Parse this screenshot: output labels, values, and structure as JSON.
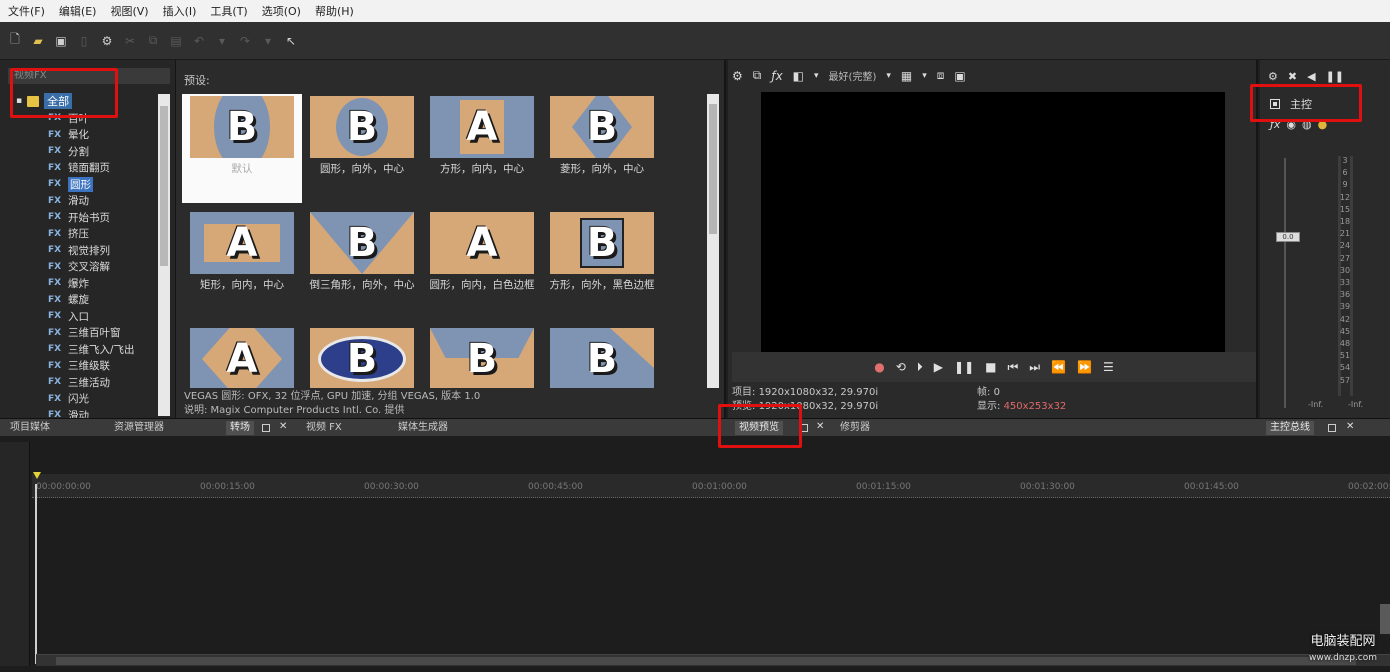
{
  "menu": [
    "文件(F)",
    "编辑(E)",
    "视图(V)",
    "插入(I)",
    "工具(T)",
    "选项(O)",
    "帮助(H)"
  ],
  "tree": {
    "header": "视频FX",
    "root_label": "全部",
    "items": [
      {
        "fx": "FX",
        "label": "百叶"
      },
      {
        "fx": "FX",
        "label": "晕化"
      },
      {
        "fx": "FX",
        "label": "分割"
      },
      {
        "fx": "FX",
        "label": "镜面翻页"
      },
      {
        "fx": "FX",
        "label": "圆形",
        "selected": true
      },
      {
        "fx": "FX",
        "label": "滑动"
      },
      {
        "fx": "FX",
        "label": "开始书页"
      },
      {
        "fx": "FX",
        "label": "挤压"
      },
      {
        "fx": "FX",
        "label": "视觉排列"
      },
      {
        "fx": "FX",
        "label": "交叉溶解"
      },
      {
        "fx": "FX",
        "label": "爆炸"
      },
      {
        "fx": "FX",
        "label": "螺旋"
      },
      {
        "fx": "FX",
        "label": "入口"
      },
      {
        "fx": "FX",
        "label": "三维百叶窗"
      },
      {
        "fx": "FX",
        "label": "三维飞入/飞出"
      },
      {
        "fx": "FX",
        "label": "三维级联"
      },
      {
        "fx": "FX",
        "label": "三维活动"
      },
      {
        "fx": "FX",
        "label": "闪光"
      },
      {
        "fx": "FX",
        "label": "滑动"
      }
    ]
  },
  "presets": {
    "label": "预设:",
    "items": [
      {
        "letter": "B",
        "caption": "默认",
        "bg": "tan",
        "shape": "circle-full",
        "selected": true
      },
      {
        "letter": "B",
        "caption": "圆形，向外，中心",
        "bg": "tan",
        "shape": "circle"
      },
      {
        "letter": "A",
        "caption": "方形，向内，中心",
        "bg": "blue",
        "shape": "square-tan"
      },
      {
        "letter": "B",
        "caption": "菱形，向外，中心",
        "bg": "tan",
        "shape": "diamond"
      },
      {
        "letter": "A",
        "caption": "矩形，向内，中心",
        "bg": "blue",
        "shape": "rect-tan"
      },
      {
        "letter": "B",
        "caption": "倒三角形，向外，中心",
        "bg": "tan",
        "shape": "triangle"
      },
      {
        "letter": "A",
        "caption": "圆形，向内，白色边框",
        "bg": "tan",
        "shape": "none"
      },
      {
        "letter": "B",
        "caption": "方形，向外，黑色边框",
        "bg": "tan",
        "shape": "square-border"
      },
      {
        "letter": "A",
        "caption": "",
        "bg": "blue",
        "shape": "diamond-tan"
      },
      {
        "letter": "B",
        "caption": "",
        "bg": "tan",
        "shape": "ellipse"
      },
      {
        "letter": "B",
        "caption": "",
        "bg": "tan",
        "shape": "trapezoid"
      },
      {
        "letter": "B",
        "caption": "",
        "bg": "blue",
        "shape": "corner"
      }
    ],
    "info_line1": "VEGAS 圆形: OFX, 32 位浮点, GPU 加速, 分组 VEGAS, 版本 1.0",
    "info_line2": "说明: Magix Computer Products Intl. Co. 提供"
  },
  "preview": {
    "quality": "最好(完整)",
    "project_label": "项目:",
    "project_value": "1920x1080x32, 29.970i",
    "preview_label": "预览:",
    "preview_value": "1920x1080x32, 29.970i",
    "frame_label": "帧:",
    "frame_value": "0",
    "display_label": "显示:",
    "display_value": "450x253x32"
  },
  "master": {
    "label": "主控",
    "meter_ticks": [
      "3",
      "6",
      "9",
      "12",
      "15",
      "18",
      "21",
      "24",
      "27",
      "30",
      "33",
      "36",
      "39",
      "42",
      "45",
      "48",
      "51",
      "54",
      "57"
    ],
    "fader_value": "0.0",
    "bottom_left": "-Inf.",
    "bottom_right": "-Inf."
  },
  "dock_tabs": {
    "project_media": "项目媒体",
    "explorer": "资源管理器",
    "transitions": "转场",
    "video_fx": "视频 FX",
    "media_generators": "媒体生成器",
    "video_preview": "视频预览",
    "trimmer": "修剪器",
    "master_bus": "主控总线"
  },
  "timeline": {
    "times": [
      "00:00:00:00",
      "00:00:15:00",
      "00:00:30:00",
      "00:00:45:00",
      "00:01:00:00",
      "00:01:15:00",
      "00:01:30:00",
      "00:01:45:00",
      "00:02:00:00"
    ]
  },
  "watermark": {
    "title": "电脑装配网",
    "url": "www.dnzp.com"
  },
  "colors": {
    "accent_red": "#e01010",
    "selection_blue": "#3b73c0",
    "thumb_tan": "#d6a877",
    "thumb_blue": "#7f94b3"
  }
}
